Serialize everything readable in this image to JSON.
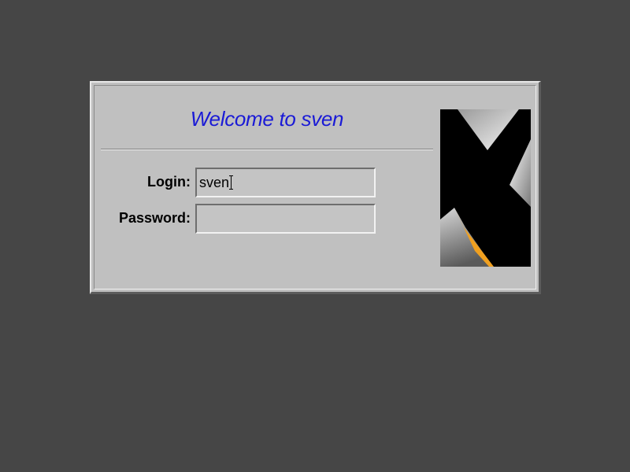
{
  "greeting": "Welcome to sven",
  "login": {
    "label": "Login:",
    "value": "sven"
  },
  "password": {
    "label": "Password:",
    "value": ""
  },
  "logo": {
    "icon": "x-logo-icon",
    "accent_color": "#f0a020"
  },
  "colors": {
    "window_background": "#c0c0c0",
    "greeting_text": "#1a1ad6"
  }
}
